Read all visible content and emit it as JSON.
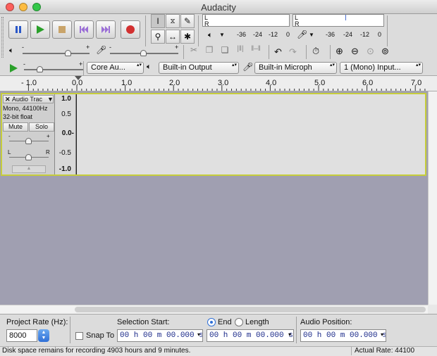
{
  "window": {
    "title": "Audacity"
  },
  "transport": {
    "pause_icon": "pause-icon",
    "play_icon": "play-icon",
    "stop_icon": "stop-icon",
    "skip_start_icon": "skip-start-icon",
    "skip_end_icon": "skip-end-icon",
    "record_icon": "record-icon"
  },
  "meters": {
    "play_channels": [
      "L",
      "R"
    ],
    "record_channels": [
      "L",
      "R"
    ],
    "play_scale": [
      "-36",
      "-24",
      "-12",
      "0"
    ],
    "record_scale": [
      "-36",
      "-24",
      "-12",
      "0"
    ]
  },
  "devices": {
    "host": "Core Au...",
    "output": "Built-in Output",
    "input": "Built-in Microph",
    "channels": "1 (Mono) Input..."
  },
  "ruler": {
    "labels": [
      "- 1.0",
      "0.0",
      "1.0",
      "2.0",
      "3.0",
      "4.0",
      "5.0",
      "6.0",
      "7.0"
    ]
  },
  "track": {
    "name": "Audio Trac",
    "rate": "Mono, 44100Hz",
    "format": "32-bit float",
    "mute_label": "Mute",
    "solo_label": "Solo",
    "gain_minus": "-",
    "gain_plus": "+",
    "pan_left": "L",
    "pan_right": "R",
    "scale": [
      "1.0",
      "0.5",
      "0.0-",
      "-0.5",
      "-1.0"
    ]
  },
  "selection_bar": {
    "project_rate_label": "Project Rate (Hz):",
    "project_rate_value": "8000",
    "snap_to_label": "Snap To",
    "selection_start_label": "Selection Start:",
    "end_label": "End",
    "length_label": "Length",
    "audio_position_label": "Audio Position:",
    "start_time": "00 h 00 m 00.000 s",
    "end_time": "00 h 00 m 00.000 s",
    "position_time": "00 h 00 m 00.000 s",
    "end_selected": true
  },
  "status": {
    "disk_space": "Disk space remains for recording 4903 hours and 9 minutes.",
    "actual_rate": "Actual Rate: 44100"
  },
  "colors": {
    "track_border": "#c6cd3b",
    "track_area_bg": "#a09fb1",
    "time_text": "#1b2a8a",
    "record_red": "#d23030",
    "play_green": "#2aa02a"
  }
}
